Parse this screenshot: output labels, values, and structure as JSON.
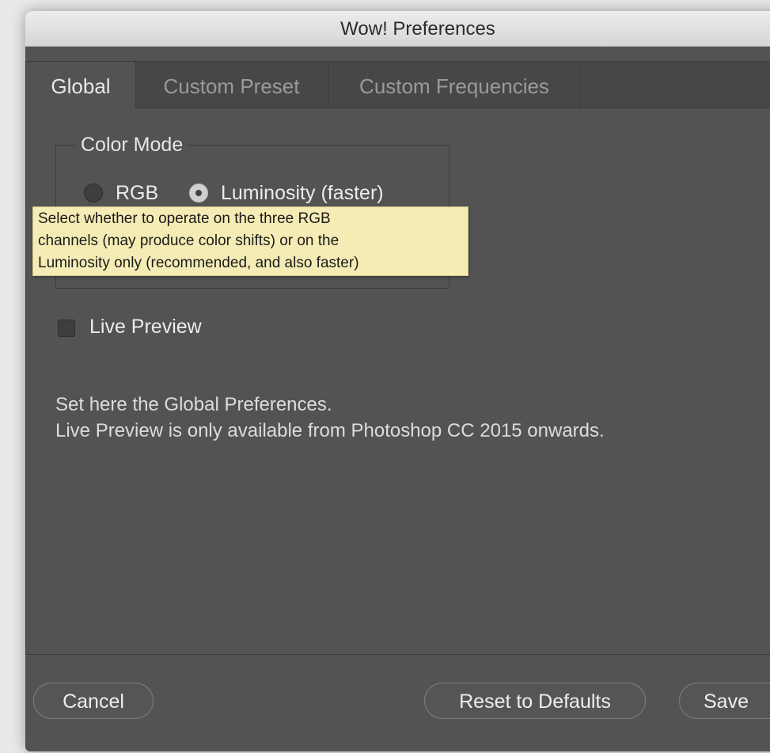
{
  "window": {
    "title": "Wow! Preferences"
  },
  "tabs": [
    {
      "label": "Global",
      "active": true
    },
    {
      "label": "Custom Preset",
      "active": false
    },
    {
      "label": "Custom Frequencies",
      "active": false
    }
  ],
  "color_mode": {
    "legend": "Color Mode",
    "options": [
      {
        "label": "RGB",
        "checked": false
      },
      {
        "label": "Luminosity (faster)",
        "checked": true
      }
    ]
  },
  "tooltip": {
    "lines": [
      "Select whether to operate on the three RGB",
      "channels (may produce color shifts) or on the",
      "Luminosity only (recommended, and also faster)"
    ]
  },
  "live_preview": {
    "label": "Live Preview",
    "checked": false
  },
  "info": {
    "line1": "Set here the Global Preferences.",
    "line2": "Live Preview is only available from Photoshop CC 2015 onwards."
  },
  "buttons": {
    "cancel": "Cancel",
    "reset": "Reset to Defaults",
    "save": "Save"
  },
  "colors": {
    "panel_bg": "#535353",
    "tooltip_bg": "#f5ecb5",
    "text": "#ececec"
  }
}
